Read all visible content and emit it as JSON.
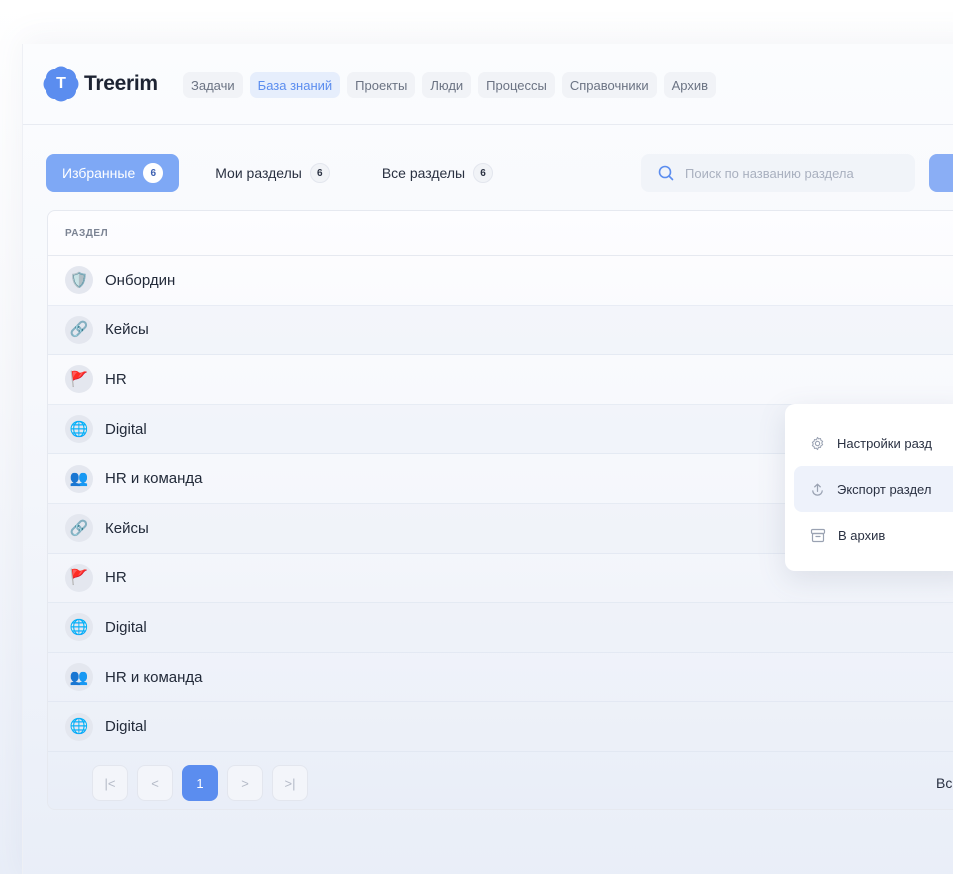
{
  "app": {
    "logo_letter": "T",
    "name": "Treerim"
  },
  "nav": [
    {
      "label": "Задачи",
      "active": false
    },
    {
      "label": "База знаний",
      "active": true
    },
    {
      "label": "Проекты",
      "active": false
    },
    {
      "label": "Люди",
      "active": false
    },
    {
      "label": "Процессы",
      "active": false
    },
    {
      "label": "Справочники",
      "active": false
    },
    {
      "label": "Архив",
      "active": false
    }
  ],
  "tabs": [
    {
      "label": "Избранные",
      "count": "6",
      "active": true
    },
    {
      "label": "Мои разделы",
      "count": "6",
      "active": false
    },
    {
      "label": "Все разделы",
      "count": "6",
      "active": false
    }
  ],
  "search": {
    "placeholder": "Поиск по названию раздела",
    "value": ""
  },
  "table": {
    "column_header": "РАЗДЕЛ",
    "rows": [
      {
        "icon": "shield-icon",
        "emoji": "🛡️",
        "label": "Онбордин"
      },
      {
        "icon": "link-icon",
        "emoji": "🔗",
        "label": "Кейсы"
      },
      {
        "icon": "flag-icon",
        "emoji": "🚩",
        "label": "HR"
      },
      {
        "icon": "globe-cursor-icon",
        "emoji": "🌐",
        "label": "Digital"
      },
      {
        "icon": "people-icon",
        "emoji": "👥",
        "label": "HR и команда"
      },
      {
        "icon": "link-icon",
        "emoji": "🔗",
        "label": "Кейсы"
      },
      {
        "icon": "flag-icon",
        "emoji": "🚩",
        "label": "HR"
      },
      {
        "icon": "globe-cursor-icon",
        "emoji": "🌐",
        "label": "Digital"
      },
      {
        "icon": "people-icon",
        "emoji": "👥",
        "label": "HR и команда"
      },
      {
        "icon": "globe-cursor-icon",
        "emoji": "🌐",
        "label": "Digital"
      }
    ]
  },
  "pagination": {
    "first": "|<",
    "prev": "<",
    "current": "1",
    "next": ">",
    "last": ">|",
    "right_text": "Вс"
  },
  "context_menu": {
    "items": [
      {
        "icon": "gear-icon",
        "label": "Настройки разд"
      },
      {
        "icon": "upload-icon",
        "label": "Экспорт раздел"
      },
      {
        "icon": "archive-icon",
        "label": "В архив"
      }
    ]
  },
  "colors": {
    "accent": "#5b8def",
    "accent_light": "#7ea8f5"
  }
}
